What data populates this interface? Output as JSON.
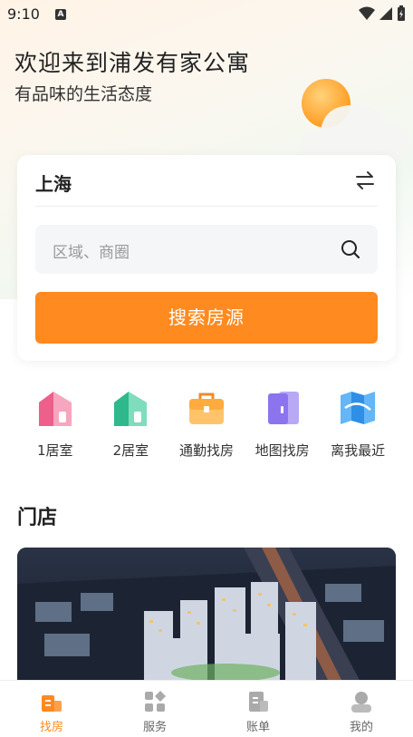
{
  "status_bar": {
    "time": "9:10",
    "notification_letter": "A"
  },
  "hero": {
    "title": "欢迎来到浦发有家公寓",
    "subtitle": "有品味的生活态度"
  },
  "search_card": {
    "city": "上海",
    "search_placeholder": "区域、商圈",
    "search_button": "搜索房源"
  },
  "quick_links": [
    {
      "label": "1居室",
      "icon": "house-pink-icon"
    },
    {
      "label": "2居室",
      "icon": "house-green-icon"
    },
    {
      "label": "通勤找房",
      "icon": "briefcase-icon"
    },
    {
      "label": "地图找房",
      "icon": "door-icon"
    },
    {
      "label": "离我最近",
      "icon": "map-icon"
    }
  ],
  "stores_section": {
    "title": "门店"
  },
  "tabs": [
    {
      "label": "找房",
      "icon": "building-icon",
      "active": true
    },
    {
      "label": "服务",
      "icon": "grid-icon",
      "active": false
    },
    {
      "label": "账单",
      "icon": "bill-icon",
      "active": false
    },
    {
      "label": "我的",
      "icon": "user-icon",
      "active": false
    }
  ],
  "colors": {
    "accent": "#ff8a1f",
    "text": "#222222",
    "muted": "#9a9a9a"
  }
}
